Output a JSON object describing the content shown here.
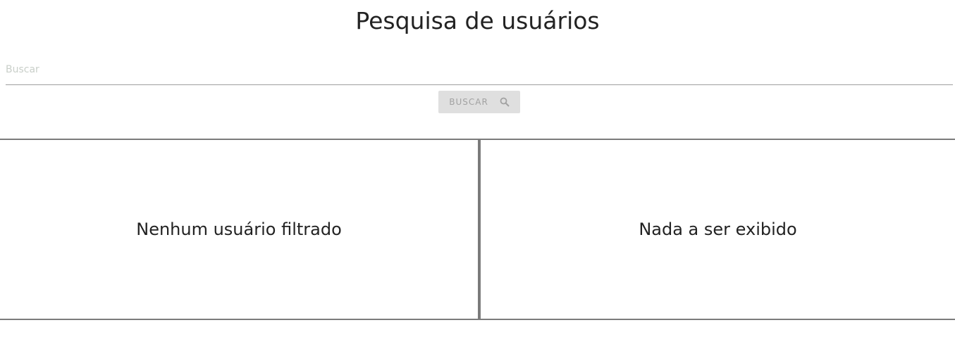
{
  "page": {
    "title": "Pesquisa de usuários"
  },
  "search": {
    "placeholder": "Buscar",
    "value": "",
    "button_label": "BUSCAR",
    "button_icon": "search-icon"
  },
  "results": {
    "left_message": "Nenhum usuário filtrado",
    "right_message": "Nada a ser exibido"
  },
  "colors": {
    "divider": "#7b7b7b",
    "button_bg": "#dfdfdf",
    "button_text": "#a2a2a2",
    "placeholder": "#c9cfc9"
  }
}
